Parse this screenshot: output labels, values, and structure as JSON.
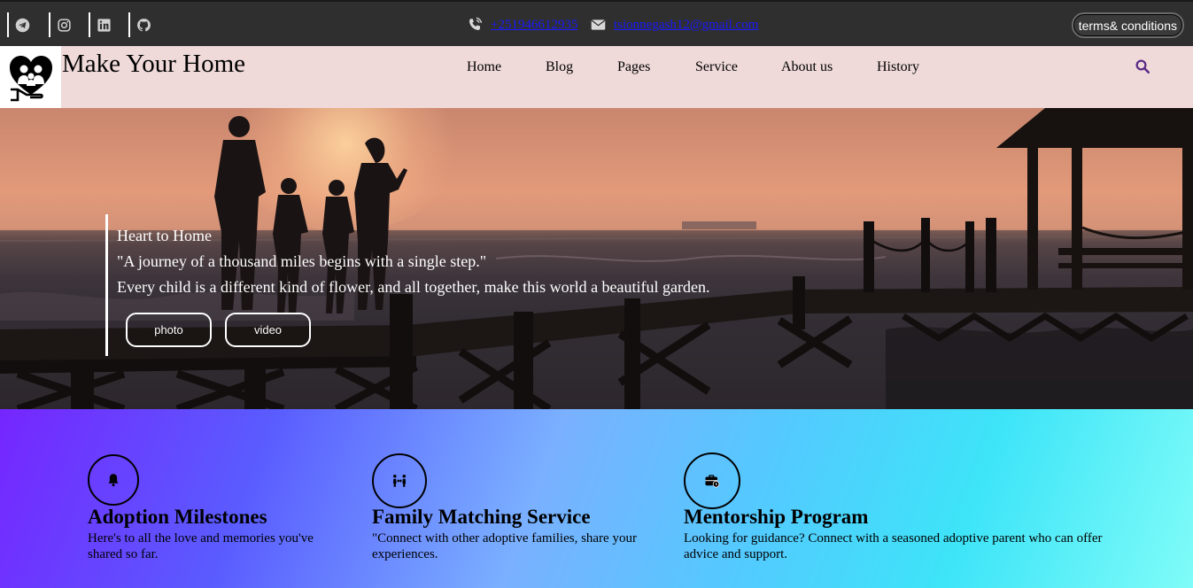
{
  "topbar": {
    "social_icons": [
      "telegram-icon",
      "instagram-icon",
      "linkedin-icon",
      "github-icon"
    ],
    "phone_icon": "phone-volume-icon",
    "phone": "+251946612935",
    "email_icon": "envelope-icon",
    "email": "tsionnegash12@gmail.com",
    "terms_label": "terms& conditions"
  },
  "header": {
    "brand": "Make Your Home",
    "nav": [
      "Home",
      "Blog",
      "Pages",
      "Service",
      "About us",
      "History"
    ],
    "search_icon": "search-icon",
    "accent_color": "#5b2a86"
  },
  "hero": {
    "tagline": "Heart to Home",
    "quote": "\"A journey of a thousand miles begins with a single step.\"",
    "subtitle": "Every child is a different kind of flower, and all together, make this world a beautiful garden.",
    "buttons": [
      "photo",
      "video"
    ]
  },
  "features": [
    {
      "icon": "bell-icon",
      "title": "Adoption Milestones",
      "text": "Here's to all the love and memories you've shared so far."
    },
    {
      "icon": "people-arrows-icon",
      "title": "Family Matching Service",
      "text": "\"Connect with other adoptive families, share your experiences."
    },
    {
      "icon": "briefcase-clock-icon",
      "title": "Mentorship Program",
      "text": "Looking for guidance? Connect with a seasoned adoptive parent who can offer advice and support."
    }
  ],
  "colors": {
    "topbar_bg": "#2f2f2f",
    "header_bg": "#efd9d9",
    "link": "#1a1aff",
    "features_gradient": [
      "#7526ff",
      "#7ab0ff",
      "#3de4f8",
      "#7ffcf8"
    ]
  }
}
